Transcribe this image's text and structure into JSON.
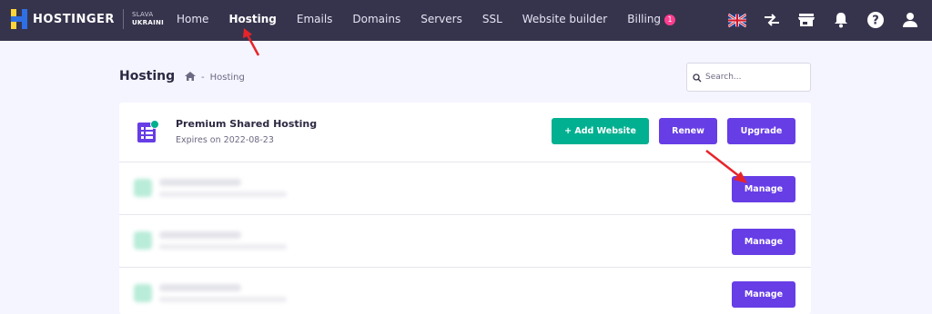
{
  "brand": {
    "name": "HOSTINGER",
    "tag_line1": "SLAVA",
    "tag_line2": "UKRAINI"
  },
  "nav": [
    {
      "label": "Home"
    },
    {
      "label": "Hosting",
      "active": true
    },
    {
      "label": "Emails"
    },
    {
      "label": "Domains"
    },
    {
      "label": "Servers"
    },
    {
      "label": "SSL"
    },
    {
      "label": "Website builder"
    },
    {
      "label": "Billing",
      "badge": "1"
    }
  ],
  "right_icons": [
    "uk-flag-icon",
    "transfer-icon",
    "store-icon",
    "bell-icon",
    "help-icon",
    "user-icon"
  ],
  "page": {
    "title": "Hosting",
    "breadcrumb_sep": "-",
    "breadcrumb_current": "Hosting"
  },
  "search": {
    "placeholder": "Search..."
  },
  "plan": {
    "name": "Premium Shared Hosting",
    "expires": "Expires on 2022-08-23",
    "add_label": "+ Add Website",
    "renew_label": "Renew",
    "upgrade_label": "Upgrade"
  },
  "sites": [
    {
      "manage_label": "Manage"
    },
    {
      "manage_label": "Manage"
    },
    {
      "manage_label": "Manage"
    }
  ],
  "colors": {
    "topbar": "#36344d",
    "accent_purple": "#673de6",
    "accent_green": "#00b090",
    "badge": "#ff3e8f",
    "annotation_arrow": "#e8242b"
  }
}
